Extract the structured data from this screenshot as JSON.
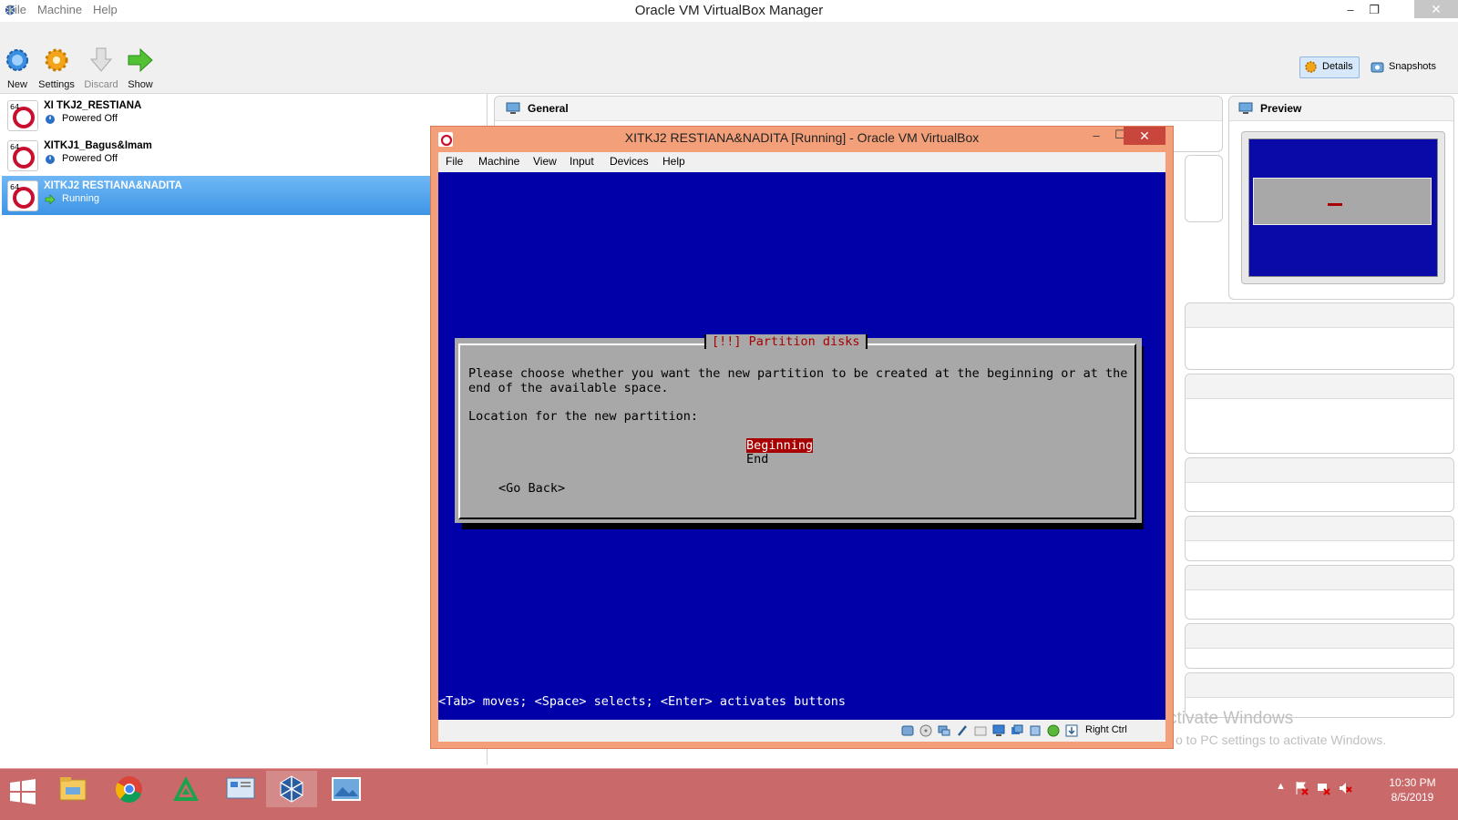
{
  "manager": {
    "title": "Oracle VM VirtualBox Manager",
    "menu": [
      "File",
      "Machine",
      "Help"
    ],
    "toolbar": {
      "new": "New",
      "settings": "Settings",
      "discard": "Discard",
      "show": "Show"
    },
    "tabs": {
      "details": "Details",
      "snapshots": "Snapshots"
    },
    "vms": [
      {
        "name": "XI TKJ2_RESTIANA",
        "state": "Powered Off"
      },
      {
        "name": "XITKJ1_Bagus&Imam",
        "state": "Powered Off"
      },
      {
        "name": "XITKJ2 RESTIANA&NADITA",
        "state": "Running"
      }
    ],
    "panels": {
      "general": "General",
      "preview": "Preview"
    },
    "watermark": {
      "line1": "ctivate Windows",
      "line2": "o to PC settings to activate Windows."
    }
  },
  "vm_window": {
    "title": "XITKJ2 RESTIANA&NADITA [Running] - Oracle VM VirtualBox",
    "menu": [
      "File",
      "Machine",
      "View",
      "Input",
      "Devices",
      "Help"
    ],
    "host_key": "Right Ctrl",
    "installer": {
      "dialog_title": "[!!] Partition disks",
      "line1": "Please choose whether you want the new partition to be created at the beginning or at the",
      "line2": "end of the available space.",
      "location_label": "Location for the new partition:",
      "options": [
        "Beginning",
        "End"
      ],
      "selected_option": "Beginning",
      "go_back": "<Go Back>",
      "help": "<Tab> moves; <Space> selects; <Enter> activates buttons"
    }
  },
  "taskbar": {
    "time": "10:30 PM",
    "date": "8/5/2019",
    "apps": [
      "start-button",
      "file-explorer",
      "chrome",
      "green-triangle-app",
      "control-panel",
      "virtualbox",
      "photos"
    ]
  },
  "colors": {
    "vm_window_frame": "#f3a07a",
    "guest_background": "#0000a8",
    "dialog_gray": "#a8a8a8",
    "selection_red": "#a80000",
    "taskbar": "#c9696a",
    "list_selected": "#3e95e6"
  }
}
